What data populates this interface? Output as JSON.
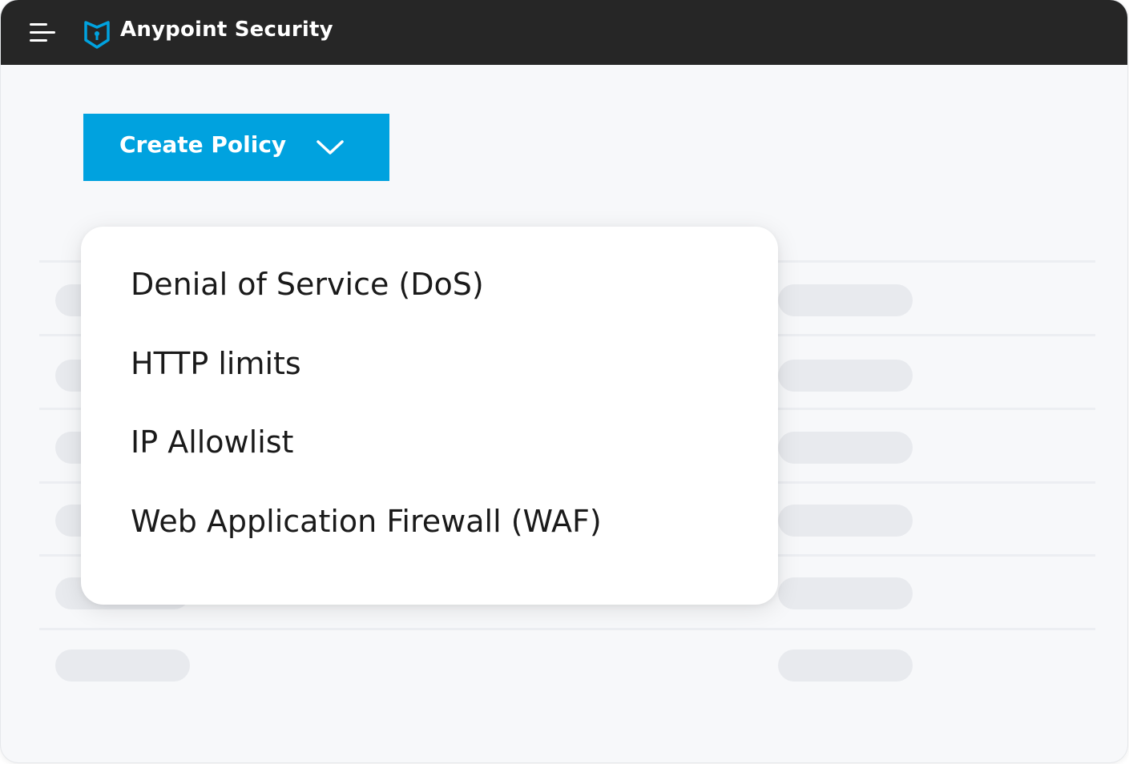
{
  "header": {
    "app_title": "Anypoint Security",
    "menu_icon": "hamburger-menu-icon",
    "logo_icon": "shield-logo-icon",
    "background_color": "#262626"
  },
  "toolbar": {
    "create_label": "Create Policy",
    "create_icon": "chevron-down-icon",
    "accent_color": "#00a2df"
  },
  "dropdown": {
    "items": [
      {
        "label": "Denial of Service (DoS)"
      },
      {
        "label": "HTTP limits"
      },
      {
        "label": "IP Allowlist"
      },
      {
        "label": "Web Application Firewall (WAF)"
      }
    ]
  }
}
